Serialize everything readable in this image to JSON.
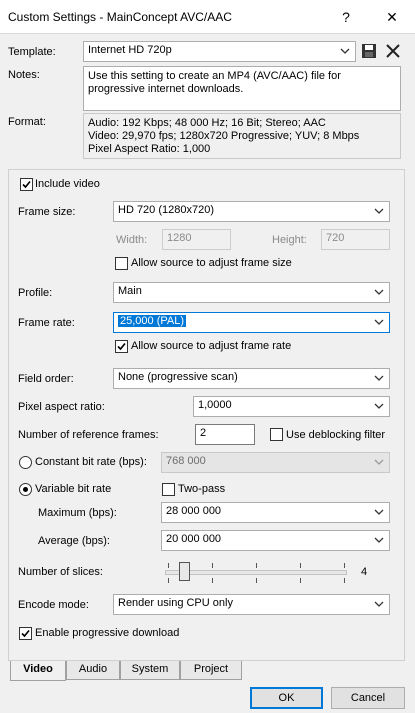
{
  "window": {
    "title": "Custom Settings - MainConcept AVC/AAC",
    "help_label": "?",
    "close_label": "✕"
  },
  "template": {
    "label": "Template:",
    "value": "Internet HD 720p"
  },
  "notes": {
    "label": "Notes:",
    "text": "Use this setting to create an MP4 (AVC/AAC) file for progressive internet downloads."
  },
  "format": {
    "label": "Format:",
    "lines": [
      "Audio: 192 Kbps; 48 000 Hz; 16 Bit; Stereo; AAC",
      "Video: 29,970 fps; 1280x720 Progressive; YUV; 8 Mbps",
      "Pixel Aspect Ratio: 1,000"
    ]
  },
  "video": {
    "include_video": "Include video",
    "include_video_checked": true,
    "frame_size": {
      "label": "Frame size:",
      "value": "HD 720 (1280x720)"
    },
    "width": {
      "label": "Width:",
      "value": "1280"
    },
    "height": {
      "label": "Height:",
      "value": "720"
    },
    "allow_adjust_frame_size": {
      "label": "Allow source to adjust frame size",
      "checked": false
    },
    "profile": {
      "label": "Profile:",
      "value": "Main"
    },
    "frame_rate": {
      "label": "Frame rate:",
      "value": "25,000 (PAL)"
    },
    "allow_adjust_frame_rate": {
      "label": "Allow source to adjust frame rate",
      "checked": true
    },
    "field_order": {
      "label": "Field order:",
      "value": "None (progressive scan)"
    },
    "pixel_aspect_ratio": {
      "label": "Pixel aspect ratio:",
      "value": "1,0000"
    },
    "reference_frames": {
      "label": "Number of reference frames:",
      "value": "2"
    },
    "deblocking": {
      "label": "Use deblocking filter",
      "checked": false
    },
    "constant_bit_rate": {
      "label": "Constant bit rate (bps):",
      "value": "768 000",
      "selected": false
    },
    "variable_bit_rate": {
      "label": "Variable bit rate",
      "selected": true
    },
    "two_pass": {
      "label": "Two-pass",
      "checked": false
    },
    "maximum": {
      "label": "Maximum (bps):",
      "value": "28 000 000"
    },
    "average": {
      "label": "Average (bps):",
      "value": "20 000 000"
    },
    "slices": {
      "label": "Number of slices:",
      "value": "4"
    },
    "encode_mode": {
      "label": "Encode mode:",
      "value": "Render using CPU only"
    },
    "progressive_download": {
      "label": "Enable progressive download",
      "checked": true
    }
  },
  "tabs": [
    "Video",
    "Audio",
    "System",
    "Project"
  ],
  "buttons": {
    "ok": "OK",
    "cancel": "Cancel"
  },
  "colors": {
    "selection": "#0078d7",
    "default_button_border": "#0078d7"
  }
}
